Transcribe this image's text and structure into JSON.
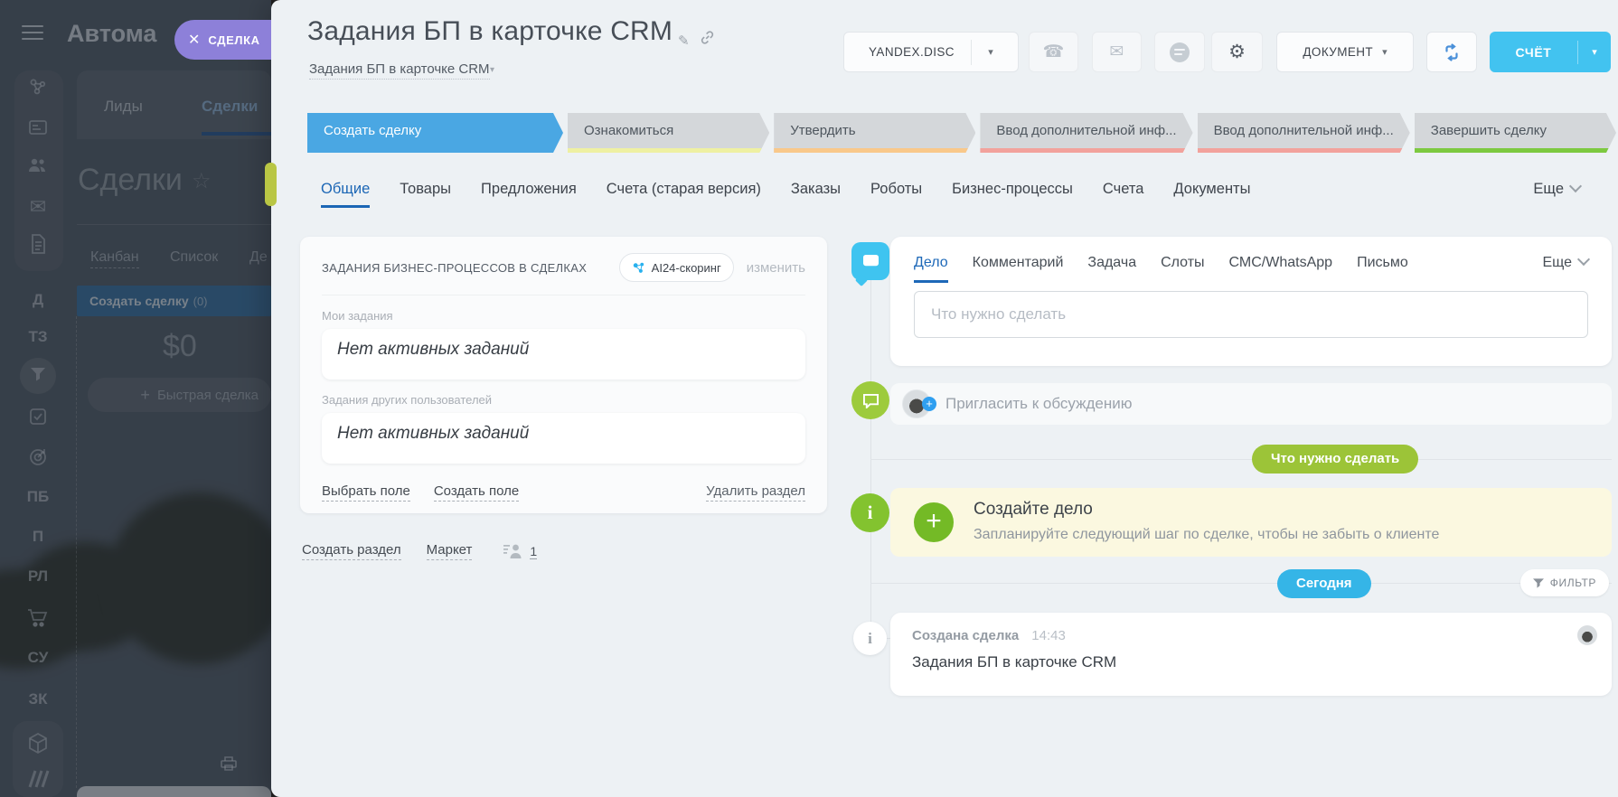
{
  "colors": {
    "panel_bg": "#edf1f4",
    "accent_blue": "#4aa7e3",
    "tab_active_blue": "#1b66b5",
    "invoice_cyan": "#42c3f0",
    "today_blue": "#35b5e7",
    "hint_green": "#9cc438",
    "plus_green": "#74ba26",
    "advice_yellow_bg": "#fbf8e0",
    "deal_badge_purple": "#8d80d9",
    "stage_gray": "#d4d7da"
  },
  "sidebar_overlay": {
    "menu_title": "Автома",
    "deal_badge": "СДЕЛКА",
    "bg_page": {
      "tab_leads": "Лиды",
      "tab_deals": "Сделки",
      "page_title": "Сделки",
      "view_kanban": "Канбан",
      "view_list": "Список",
      "view_extra": "Де",
      "kanban_column_title": "Создать сделку",
      "kanban_column_count": "(0)",
      "kanban_amount": "$0",
      "quick_deal_button": "Быстрая сделка",
      "rail_letters": [
        "Д",
        "ТЗ",
        "ПБ",
        "П",
        "РЛ",
        "СУ",
        "ЗК"
      ]
    }
  },
  "header": {
    "title": "Задания БП в карточке CRM",
    "subtitle": "Задания БП в карточке CRM",
    "storage_button": "YANDEX.DISC",
    "document_button": "ДОКУМЕНТ",
    "invoice_button": "СЧЁТ"
  },
  "stages": [
    {
      "label": "Создать сделку",
      "color": "#4aa7e3",
      "active": true
    },
    {
      "label": "Ознакомиться",
      "color": "#eef0a2",
      "active": false
    },
    {
      "label": "Утвердить",
      "color": "#f9c88a",
      "active": false
    },
    {
      "label": "Ввод дополнительной инф...",
      "color": "#f2a29c",
      "active": false
    },
    {
      "label": "Ввод дополнительной инф...",
      "color": "#f2a29c",
      "active": false
    },
    {
      "label": "Завершить сделку",
      "color": "#7dc940",
      "active": false
    }
  ],
  "tabs": {
    "active": "Общие",
    "items": [
      "Общие",
      "Товары",
      "Предложения",
      "Счета (старая версия)",
      "Заказы",
      "Роботы",
      "Бизнес-процессы",
      "Счета",
      "Документы"
    ],
    "more": "Еще"
  },
  "section_card": {
    "title": "ЗАДАНИЯ БИЗНЕС-ПРОЦЕССОВ В СДЕЛКАХ",
    "badge": "AI24-скоринг",
    "edit_link": "изменить",
    "fields": [
      {
        "label": "Мои задания",
        "value": "Нет активных заданий"
      },
      {
        "label": "Задания других пользователей",
        "value": "Нет активных заданий"
      }
    ],
    "select_field_link": "Выбрать поле",
    "create_field_link": "Создать поле",
    "delete_section_link": "Удалить раздел"
  },
  "footer_links": {
    "create_section": "Создать раздел",
    "market": "Маркет",
    "members_count": "1"
  },
  "timeline": {
    "tabs": [
      "Дело",
      "Комментарий",
      "Задача",
      "Слоты",
      "СМС/WhatsApp",
      "Письмо"
    ],
    "active_tab": "Дело",
    "more": "Еще",
    "input_placeholder": "Что нужно сделать",
    "invite_label": "Пригласить к обсуждению",
    "hint_pill": "Что нужно сделать",
    "advice_title": "Создайте дело",
    "advice_text": "Запланируйте следующий шаг по сделке, чтобы не забыть о клиенте",
    "date_pill": "Сегодня",
    "filter_button": "ФИЛЬТР",
    "event": {
      "title": "Создана сделка",
      "time": "14:43",
      "text": "Задания БП в карточке CRM"
    }
  }
}
